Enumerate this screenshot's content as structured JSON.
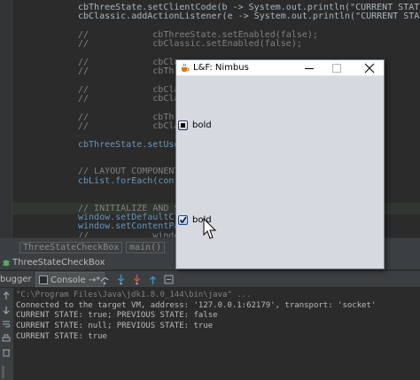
{
  "editor": {
    "lines": [
      {
        "text": "cbThreeState.setClientCode(b -> System.out.println(\"CURRENT STATE: \" +",
        "style": "code"
      },
      {
        "text": "cbClassic.addActionListener(e -> System.out.println(\"CURRENT STATE: \" +",
        "style": "code"
      },
      {
        "text": "",
        "style": "code"
      },
      {
        "text": "//            cbThreeState.setEnabled(false);",
        "style": "comment"
      },
      {
        "text": "//            cbClassic.setEnabled(false);",
        "style": "comment"
      },
      {
        "text": "",
        "style": "code"
      },
      {
        "text": "//            cbClas",
        "style": "comment"
      },
      {
        "text": "//            cbThre",
        "style": "comment"
      },
      {
        "text": "",
        "style": "code"
      },
      {
        "text": "//            cbClas",
        "style": "comment"
      },
      {
        "text": "//            cbClas",
        "style": "comment"
      },
      {
        "text": "",
        "style": "code"
      },
      {
        "text": "//            cbThre",
        "style": "comment"
      },
      {
        "text": "//            cbClas",
        "style": "comment"
      },
      {
        "text": "",
        "style": "code"
      },
      {
        "text": "cbThreeState.setUse",
        "style": "blue"
      },
      {
        "text": "",
        "style": "code"
      },
      {
        "text": "",
        "style": "code"
      },
      {
        "text": "// LAYOUT COMPONENTS",
        "style": "comment"
      },
      {
        "text": "cbList.forEach(conte",
        "style": "blue"
      },
      {
        "text": "",
        "style": "code"
      },
      {
        "text": "",
        "style": "code"
      },
      {
        "text": "// INITIALIZE AND SH",
        "style": "comment"
      },
      {
        "text": "window.setDefaultClo                        :",
        "style": "blue"
      },
      {
        "text": "window.setContentPan",
        "style": "blue"
      },
      {
        "text": "//            window",
        "style": "comment"
      }
    ]
  },
  "tabs": {
    "tab1": "ThreeStateCheckBox",
    "tab2": "main()"
  },
  "tool_window": {
    "title": "ThreeStateCheckBox",
    "debugger_label": "bugger",
    "console_tab": "Console →*"
  },
  "console": {
    "lines": [
      {
        "text": "\"C:\\Program Files\\Java\\jdk1.8.0_144\\bin\\java\" ...",
        "style": "cmd"
      },
      {
        "text": "Connected to the target VM, address: '127.0.0.1:62179', transport: 'socket'",
        "style": "out"
      },
      {
        "text": "CURRENT STATE: true; PREVIOUS STATE: false",
        "style": "out"
      },
      {
        "text": "CURRENT STATE: null; PREVIOUS STATE: true",
        "style": "out"
      },
      {
        "text": "CURRENT STATE: true",
        "style": "out"
      }
    ]
  },
  "lnf_window": {
    "title": "L&F: Nimbus",
    "checkbox1": {
      "label": "bold",
      "state": "indeterminate"
    },
    "checkbox2": {
      "label": "bold",
      "state": "checked"
    }
  },
  "colors": {
    "editor_bg": "#2b2b2b",
    "comment": "#808080",
    "field": "#6897bb",
    "window_bg": "#d6d9df"
  }
}
